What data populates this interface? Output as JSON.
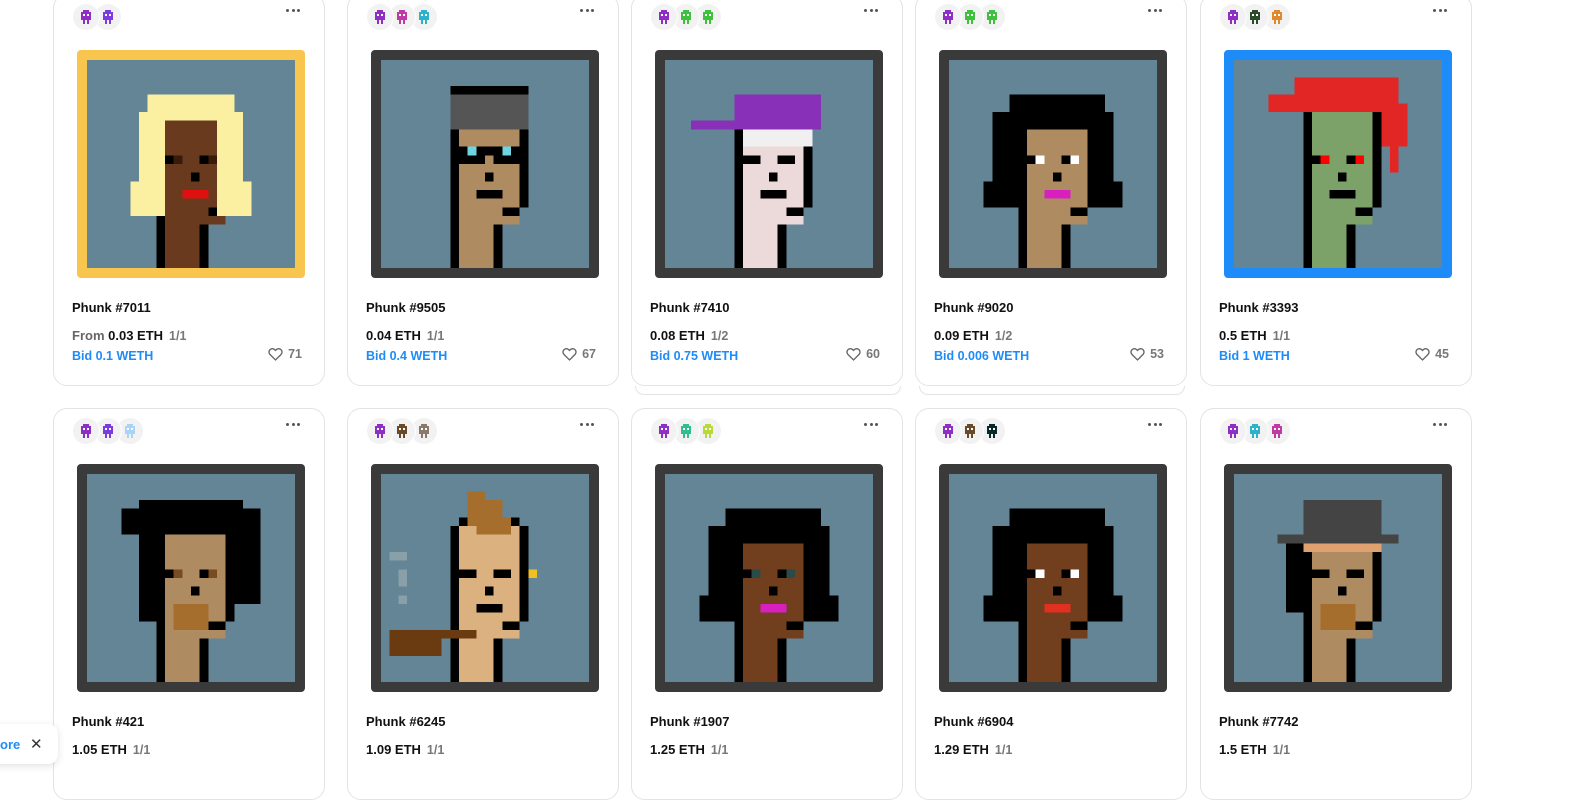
{
  "ui": {
    "like_icon": "heart-icon",
    "menu_icon": "more-dots-icon",
    "accent": "#1d8cf8"
  },
  "cards": [
    {
      "title": "Phunk #7011",
      "price_prefix": "From",
      "price": "0.03 ETH",
      "edition": "1/1",
      "bid": "Bid 0.1 WETH",
      "likes": "71",
      "frame_color": "#f8c54f",
      "owners": [
        "#8f2ec4",
        "#7c3ae0"
      ],
      "punk": {
        "skin": "#6a3a1e",
        "hair": "#fbf0a2",
        "hat": "",
        "mouth": "#e01010",
        "eyes": "#3a1a08"
      }
    },
    {
      "title": "Phunk #9505",
      "price_prefix": "",
      "price": "0.04 ETH",
      "edition": "1/1",
      "bid": "Bid 0.4 WETH",
      "likes": "67",
      "frame_color": "#3a3a3a",
      "owners": [
        "#8f2ec4",
        "#c03aa6",
        "#2db3c9"
      ],
      "punk": {
        "skin": "#ae8b61",
        "hair": "#000000",
        "hat": "#555555",
        "mouth": "#000000",
        "eyes": "#6fd3e0",
        "glasses": true
      }
    },
    {
      "title": "Phunk #7410",
      "price_prefix": "",
      "price": "0.08 ETH",
      "edition": "1/2",
      "bid": "Bid 0.75 WETH",
      "likes": "60",
      "frame_color": "#3a3a3a",
      "owners": [
        "#8f2ec4",
        "#3ec23e",
        "#3ec23e"
      ],
      "stacked": true,
      "punk": {
        "skin": "#ebdad9",
        "hair": "#000000",
        "hat": "#8830b8",
        "mouth": "#000000",
        "eyes": "#000000",
        "cap": true
      }
    },
    {
      "title": "Phunk #9020",
      "price_prefix": "",
      "price": "0.09 ETH",
      "edition": "1/2",
      "bid": "Bid 0.006 WETH",
      "likes": "53",
      "frame_color": "#3a3a3a",
      "owners": [
        "#8f2ec4",
        "#3ec23e",
        "#3ec23e"
      ],
      "stacked": true,
      "punk": {
        "skin": "#ae8b61",
        "hair": "#000000",
        "hat": "",
        "mouth": "#d81fc0",
        "eyes": "#ffffff"
      }
    },
    {
      "title": "Phunk #3393",
      "price_prefix": "",
      "price": "0.5 ETH",
      "edition": "1/1",
      "bid": "Bid 1 WETH",
      "likes": "45",
      "frame_color": "#1d8cf8",
      "owners": [
        "#8f2ec4",
        "#2d4a2a",
        "#e08a2e"
      ],
      "punk": {
        "skin": "#7da269",
        "hair": "#e22626",
        "hat": "",
        "mouth": "#000000",
        "eyes": "#ff0000"
      }
    },
    {
      "title": "Phunk #421",
      "price_prefix": "",
      "price": "1.05 ETH",
      "edition": "1/1",
      "bid": "",
      "likes": "",
      "frame_color": "#3a3a3a",
      "owners": [
        "#8f2ec4",
        "#7c3ae0",
        "#a8d4f5"
      ],
      "punk": {
        "skin": "#ae8b61",
        "hair": "#000000",
        "hat": "",
        "mouth": "#000000",
        "eyes": "#7a4a20",
        "beard": "#a66e2c"
      }
    },
    {
      "title": "Phunk #6245",
      "price_prefix": "",
      "price": "1.09 ETH",
      "edition": "1/1",
      "bid": "",
      "likes": "",
      "frame_color": "#3a3a3a",
      "owners": [
        "#8f2ec4",
        "#6b4a2a",
        "#8a7a6a"
      ],
      "punk": {
        "skin": "#dbb180",
        "hair": "#a66e2c",
        "hat": "",
        "mouth": "#000000",
        "eyes": "#000000",
        "pipe": true
      }
    },
    {
      "title": "Phunk #1907",
      "price_prefix": "",
      "price": "1.25 ETH",
      "edition": "1/1",
      "bid": "",
      "likes": "",
      "frame_color": "#3a3a3a",
      "owners": [
        "#8f2ec4",
        "#2fbf8f",
        "#b8d93a"
      ],
      "punk": {
        "skin": "#713f1d",
        "hair": "#000000",
        "hat": "",
        "mouth": "#d81fc0",
        "eyes": "#2b4a4a"
      }
    },
    {
      "title": "Phunk #6904",
      "price_prefix": "",
      "price": "1.29 ETH",
      "edition": "1/1",
      "bid": "",
      "likes": "",
      "frame_color": "#3a3a3a",
      "owners": [
        "#8f2ec4",
        "#6b4a2a",
        "#0a2a2a"
      ],
      "punk": {
        "skin": "#713f1d",
        "hair": "#000000",
        "hat": "",
        "mouth": "#e03020",
        "eyes": "#ffffff"
      }
    },
    {
      "title": "Phunk #7742",
      "price_prefix": "",
      "price": "1.5 ETH",
      "edition": "1/1",
      "bid": "",
      "likes": "",
      "frame_color": "#3a3a3a",
      "owners": [
        "#8f2ec4",
        "#2db3c9",
        "#c03aa6"
      ],
      "punk": {
        "skin": "#ae8b61",
        "hair": "#000000",
        "hat": "#444444",
        "mouth": "#000000",
        "eyes": "#000000",
        "beard": "#a66e2c"
      }
    }
  ],
  "toast": {
    "more_label": "ore",
    "close_label": "✕"
  }
}
